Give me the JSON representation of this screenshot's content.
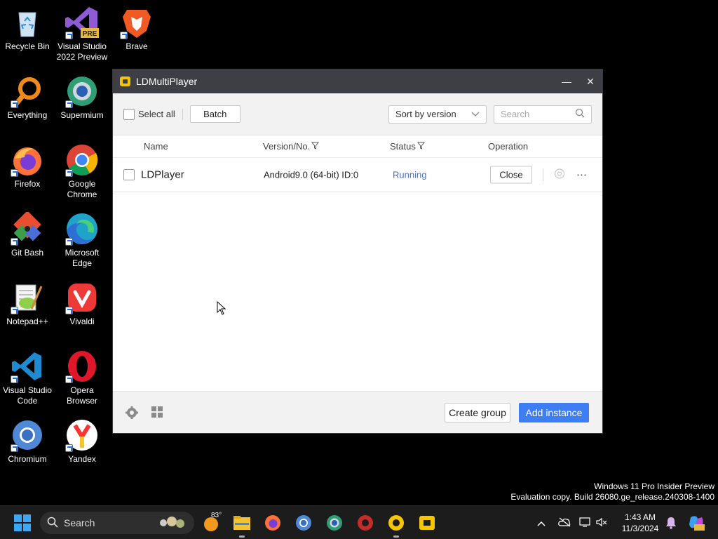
{
  "desktop_icons": [
    {
      "label": "Recycle Bin",
      "icon": "recycle-bin-icon"
    },
    {
      "label": "Visual Studio 2022 Preview",
      "icon": "visual-studio-icon"
    },
    {
      "label": "Brave",
      "icon": "brave-icon"
    },
    {
      "label": "Everything",
      "icon": "everything-icon"
    },
    {
      "label": "Supermium",
      "icon": "supermium-icon"
    },
    {
      "label": "Firefox",
      "icon": "firefox-icon"
    },
    {
      "label": "Google Chrome",
      "icon": "chrome-icon"
    },
    {
      "label": "Git Bash",
      "icon": "git-bash-icon"
    },
    {
      "label": "Microsoft Edge",
      "icon": "edge-icon"
    },
    {
      "label": "Notepad++",
      "icon": "notepadpp-icon"
    },
    {
      "label": "Vivaldi",
      "icon": "vivaldi-icon"
    },
    {
      "label": "Visual Studio Code",
      "icon": "vscode-icon"
    },
    {
      "label": "Opera Browser",
      "icon": "opera-icon"
    },
    {
      "label": "Chromium",
      "icon": "chromium-icon"
    },
    {
      "label": "Yandex",
      "icon": "yandex-icon"
    }
  ],
  "window": {
    "title": "LDMultiPlayer",
    "minimize_glyph": "—",
    "close_glyph": "✕"
  },
  "toolbar": {
    "select_all_label": "Select all",
    "batch_label": "Batch",
    "sort_value": "Sort by version",
    "search_placeholder": "Search"
  },
  "table": {
    "headers": {
      "name": "Name",
      "version": "Version/No.",
      "status": "Status",
      "operation": "Operation"
    },
    "rows": [
      {
        "name": "LDPlayer",
        "version": "Android9.0 (64-bit) ID:0",
        "status": "Running",
        "action": "Close",
        "more": "⋯"
      }
    ]
  },
  "footer": {
    "create_group_label": "Create group",
    "add_instance_label": "Add instance"
  },
  "watermark": {
    "line1": "Windows 11 Pro Insider Preview",
    "line2": "Evaluation copy. Build 26080.ge_release.240308-1400"
  },
  "taskbar": {
    "search_label": "Search",
    "weather_temp": "83°",
    "time": "1:43 AM",
    "date": "11/3/2024"
  },
  "colors": {
    "accent": "#3d7ef5",
    "status_running": "#4a72c8",
    "titlebar": "#3e3f45"
  }
}
